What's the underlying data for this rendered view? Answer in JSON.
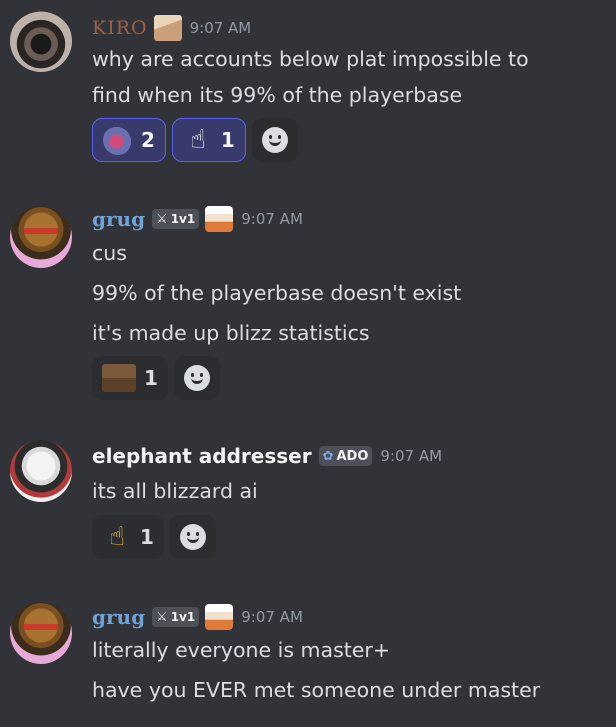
{
  "messages": [
    {
      "author": "KIRO",
      "timestamp": "9:07 AM",
      "lines": [
        "why are accounts below plat impossible to",
        "find when its 99% of the playerbase"
      ],
      "reactions": [
        {
          "emoji": "blob-emoji",
          "count": "2",
          "active": true
        },
        {
          "emoji": "pointing-up-hand-emoji",
          "count": "1",
          "active": true
        }
      ]
    },
    {
      "author": "grug",
      "tag": "1v1",
      "timestamp": "9:07 AM",
      "lines": [
        "cus",
        "99% of the playerbase doesn't exist",
        "it's made up blizz statistics"
      ],
      "reactions": [
        {
          "emoji": "otter-emoji",
          "count": "1",
          "active": false
        }
      ]
    },
    {
      "author": "elephant addresser",
      "tag": "ADO",
      "timestamp": "9:07 AM",
      "lines": [
        "its all blizzard ai"
      ],
      "reactions": [
        {
          "emoji": "pointing-up-hand-emoji",
          "count": "1",
          "active": false
        }
      ]
    },
    {
      "author": "grug",
      "tag": "1v1",
      "timestamp": "9:07 AM",
      "lines": [
        "literally everyone is master+",
        "have you EVER met someone under master"
      ]
    }
  ],
  "icons": {
    "sword": "⚔",
    "flower": "✿",
    "hand": "☝"
  },
  "colors": {
    "background": "#313338",
    "kiro_name": "#a0603f",
    "grug_name": "#6fa2d6",
    "timestamp": "#949ba4",
    "active_reaction_border": "#5865f2"
  }
}
